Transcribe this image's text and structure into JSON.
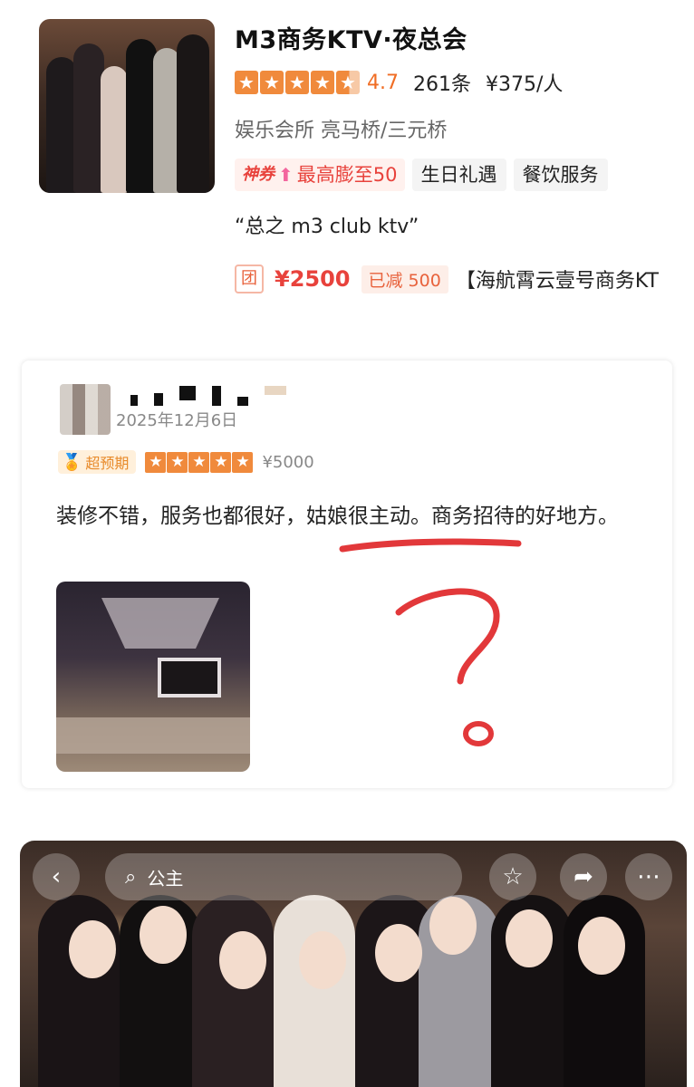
{
  "listing": {
    "title": "M3商务KTV·夜总会",
    "rating": "4.7",
    "review_count": "261条",
    "price_per_person": "¥375/人",
    "category": "娱乐会所  亮马桥/三元桥",
    "promo_tag_label": "神券",
    "promo_tag_text": "最高膨至50",
    "tags": [
      "生日礼遇",
      "餐饮服务"
    ],
    "quote": "“总之 m3 club ktv”",
    "deal": {
      "badge": "团",
      "price": "¥2500",
      "discount": "已减 500",
      "name": "【海航霄云壹号商务KT"
    }
  },
  "review": {
    "date": "2025年12月6日",
    "badge": "超预期",
    "price": "¥5000",
    "text": "装修不错，服务也都很好，姑娘很主动。商务招待的好地方。"
  },
  "gallery": {
    "search_text": "公主"
  },
  "icons": {
    "back": "chevron-left-icon",
    "search": "search-icon",
    "favorite": "star-icon",
    "share": "share-icon",
    "more": "more-icon"
  },
  "colors": {
    "accent_orange": "#f06d24",
    "star_orange": "#f08a3c",
    "deal_red": "#e8423c",
    "scribble_red": "#e2383a"
  }
}
